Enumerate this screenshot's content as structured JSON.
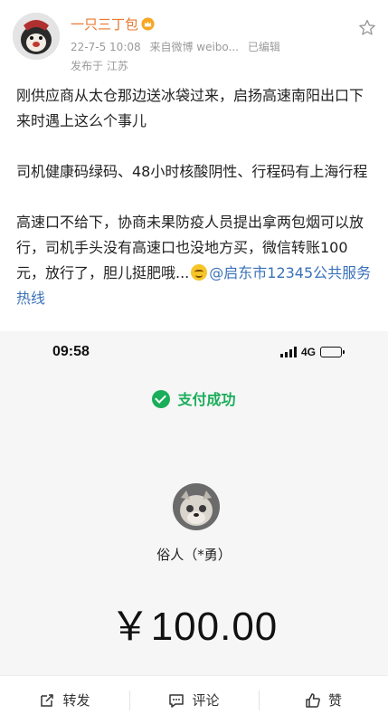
{
  "post": {
    "author": "一只三丁包",
    "date": "22-7-5 10:08",
    "source": "来自微博 weibo...",
    "edited": "已编辑",
    "location": "发布于 江苏",
    "para1": "刚供应商从太仓那边送冰袋过来，启扬高速南阳出口下来时遇上这么个事儿",
    "para2": "司机健康码绿码、48小时核酸阴性、行程码有上海行程",
    "para3": "高速口不给下，协商未果防疫人员提出拿两包烟可以放行，司机手头没有高速口也没地方买，微信转账100元，放行了，胆儿挺肥哦...",
    "mention": "@启东市12345公共服务热线"
  },
  "screenshot": {
    "time": "09:58",
    "network": "4G",
    "battery_level": 0.7,
    "pay_status": "支付成功",
    "payee": "俗人（*勇）",
    "amount": "￥100.00"
  },
  "actions": {
    "repost": "转发",
    "comment": "评论",
    "like": "赞"
  },
  "colors": {
    "author": "#e8792f",
    "link": "#3a72b8",
    "wechat_green": "#1aad5a"
  },
  "icons": [
    "vip-crown-icon",
    "star-icon",
    "signal-icon",
    "battery-icon",
    "check-icon",
    "repost-icon",
    "comment-icon",
    "like-icon",
    "smile-emoji-icon"
  ]
}
